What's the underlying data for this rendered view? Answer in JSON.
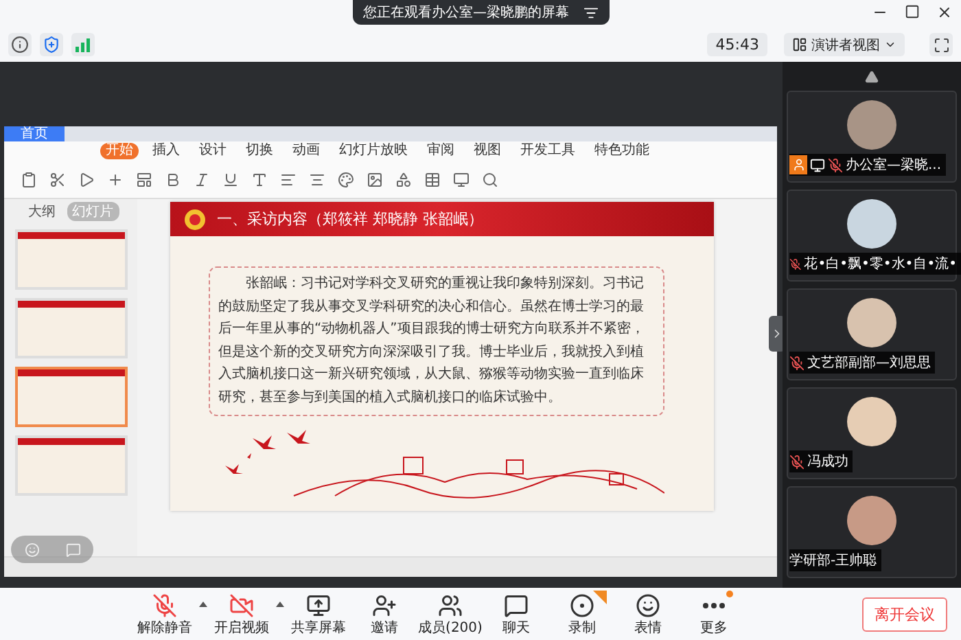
{
  "viewing_banner": {
    "text": "您正在观看办公室—梁晓鹏的屏幕"
  },
  "toolbar": {
    "timer": "45:43",
    "view_button": "演讲者视图"
  },
  "shared_screen": {
    "app_tabs": [
      {
        "label": "首页",
        "selected": true
      }
    ],
    "menu_tabs": [
      {
        "label": "开始",
        "selected": true
      },
      {
        "label": "插入",
        "selected": false
      },
      {
        "label": "设计",
        "selected": false
      },
      {
        "label": "切换",
        "selected": false
      },
      {
        "label": "动画",
        "selected": false
      },
      {
        "label": "幻灯片放映",
        "selected": false
      },
      {
        "label": "审阅",
        "selected": false
      },
      {
        "label": "视图",
        "selected": false
      },
      {
        "label": "开发工具",
        "selected": false
      },
      {
        "label": "特色功能",
        "selected": false
      }
    ],
    "panel_tabs": [
      {
        "label": "大纲",
        "selected": false
      },
      {
        "label": "幻灯片",
        "selected": true
      }
    ],
    "thumbnails": [
      {
        "selected": false
      },
      {
        "selected": false
      },
      {
        "selected": true
      },
      {
        "selected": false
      }
    ],
    "slide": {
      "title": "一、采访内容（郑筱祥 郑晓静 张韶岷）",
      "paragraph": "张韶岷：习书记对学科交叉研究的重视让我印象特别深刻。习书记的鼓励坚定了我从事交叉学科研究的决心和信心。虽然在博士学习的最后一年里从事的“动物机器人”项目跟我的博士研究方向联系并不紧密，但是这个新的交叉研究方向深深吸引了我。博士毕业后，我就投入到植入式脑机接口这一新兴研究领域，从大鼠、猕猴等动物实验一直到临床研究，甚至参与到美国的植入式脑机接口的临床试验中。"
    }
  },
  "participants": [
    {
      "name": "办公室—梁晓...",
      "muted": true,
      "host": true,
      "sharing": true,
      "color": "#a89486"
    },
    {
      "name": "花•白•飘•零•水•自•流•",
      "muted": true,
      "host": false,
      "sharing": false,
      "color": "#c9d6e0"
    },
    {
      "name": "文艺部副部—刘思思",
      "muted": true,
      "host": false,
      "sharing": false,
      "color": "#d8c2ae"
    },
    {
      "name": "冯成功",
      "muted": true,
      "host": false,
      "sharing": false,
      "color": "#e6cdb4"
    },
    {
      "name": "学研部-王帅聪",
      "muted": false,
      "host": false,
      "sharing": false,
      "color": "#c79a86"
    }
  ],
  "bottom_bar": {
    "buttons": [
      {
        "kind": "mic",
        "label": "解除静音",
        "caret": true
      },
      {
        "kind": "video",
        "label": "开启视频",
        "caret": true
      },
      {
        "kind": "share",
        "label": "共享屏幕",
        "caret": false
      },
      {
        "kind": "invite",
        "label": "邀请",
        "caret": false
      },
      {
        "kind": "members",
        "label": "成员(200)",
        "caret": false
      },
      {
        "kind": "chat",
        "label": "聊天",
        "caret": false
      },
      {
        "kind": "record",
        "label": "录制",
        "caret": false
      },
      {
        "kind": "emoji",
        "label": "表情",
        "caret": false
      },
      {
        "kind": "more",
        "label": "更多",
        "caret": false
      }
    ],
    "leave_button": "离开会议"
  }
}
